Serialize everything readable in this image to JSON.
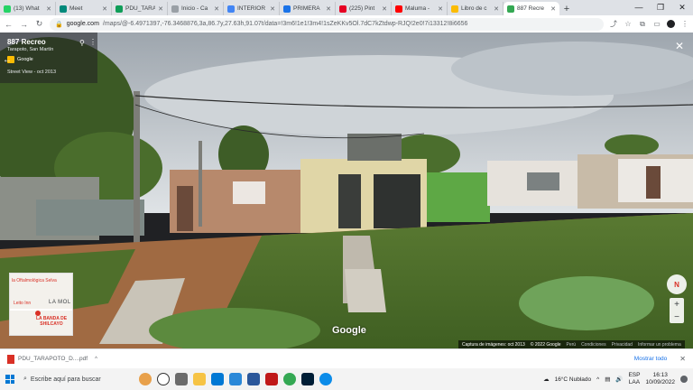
{
  "tabs": [
    {
      "label": "(13) What",
      "color": "#25d366"
    },
    {
      "label": "Meet",
      "color": "#00897b"
    },
    {
      "label": "PDU_TARA",
      "color": "#0f9d58"
    },
    {
      "label": "Inicio - Ca",
      "color": "#9aa0a6"
    },
    {
      "label": "INTERIOR",
      "color": "#4285f4"
    },
    {
      "label": "PRIMERA",
      "color": "#1a73e8"
    },
    {
      "label": "(225) Pint",
      "color": "#e60023"
    },
    {
      "label": "Maluma -",
      "color": "#ff0000"
    },
    {
      "label": "Libro de c",
      "color": "#fbbc04"
    },
    {
      "label": "887 Recre",
      "color": "#34a853"
    }
  ],
  "address": {
    "host": "google.com",
    "path": "/maps/@-6.4971397,-76.3468876,3a,86.7y,27.63h,91.07t/data=!3m6!1e1!3m4!1sZeKKv5Ol.7dC7kZtdwp-RJQ!2e0!7i13312!8i6656"
  },
  "streetview": {
    "place_title": "887 Recreo",
    "place_subtitle": "Tarapoto, San Martín",
    "provider": "Google",
    "capture_label": "Street View - oct 2013",
    "logo": "Google",
    "attribution": "Captura de imágenes: oct 2013",
    "copyright": "© 2022 Google",
    "country": "Perú",
    "terms": "Condiciones",
    "privacy": "Privacidad",
    "report": "Informar un problema",
    "compass_letter": "N",
    "zoom_in": "+",
    "zoom_out": "−",
    "back_glyph": "←",
    "close_glyph": "✕",
    "pin_glyph": "⚲",
    "more_glyph": "⋮"
  },
  "minimap": {
    "label1": "la Oftalmológica Selva",
    "label2": "Leito Inn",
    "label3": "LA MOL",
    "label4": "LA BANDA DE SHILCAYO"
  },
  "downloads": {
    "file_name": "PDU_TARAPOTO_D....pdf",
    "chevron": "^",
    "show_all": "Mostrar todo",
    "close": "✕"
  },
  "taskbar": {
    "search_placeholder": "Escribe aquí para buscar",
    "weather": "16°C  Nublado",
    "language": "ESP",
    "layout": "LAA",
    "time": "16:13",
    "date": "10/09/2022"
  },
  "window_controls": {
    "minimize": "—",
    "maximize": "❐",
    "close": "✕"
  },
  "nav": {
    "back": "←",
    "forward": "→",
    "reload": "↻",
    "newtab": "+"
  }
}
